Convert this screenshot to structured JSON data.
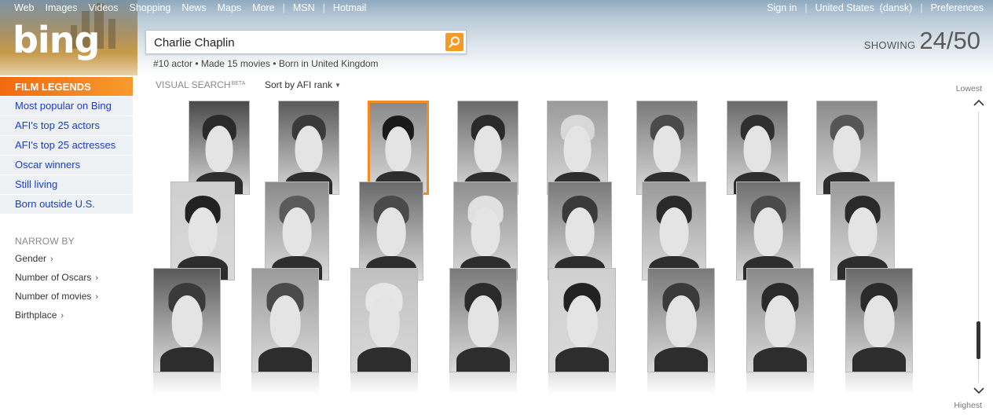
{
  "nav": {
    "left": [
      "Web",
      "Images",
      "Videos",
      "Shopping",
      "News",
      "Maps",
      "More"
    ],
    "msn": "MSN",
    "hotmail": "Hotmail",
    "right": [
      "Sign in",
      "United States  (dansk)",
      "Preferences"
    ]
  },
  "logo": "bing",
  "search": {
    "value": "Charlie Chaplin",
    "button_icon": "search-icon"
  },
  "result_summary": "#10 actor • Made 15 movies • Born in United Kingdom",
  "showing": {
    "label": "SHOWING",
    "count": "24/50",
    "shown": 24,
    "total": 50
  },
  "sidebar": {
    "header": "FILM LEGENDS",
    "items": [
      "Most popular on Bing",
      "AFI's top 25 actors",
      "AFI's top 25 actresses",
      "Oscar winners",
      "Still living",
      "Born outside U.S."
    ],
    "narrow_header": "NARROW BY",
    "narrow_items": [
      "Gender",
      "Number of Oscars",
      "Number of movies",
      "Birthplace"
    ]
  },
  "visual_search": {
    "label": "VISUAL SEARCH",
    "beta": "BETA"
  },
  "sort": {
    "label": "Sort by AFI rank",
    "icon": "dropdown-triangle-icon"
  },
  "results_grid": {
    "rows": [
      [
        {
          "tone": "#4a4a4a",
          "hair": "#2a2a2a"
        },
        {
          "tone": "#5a5a5a",
          "hair": "#3a3a3a"
        },
        {
          "tone": "#8a8a8a",
          "hair": "#1a1a1a",
          "selected": true
        },
        {
          "tone": "#6a6a6a",
          "hair": "#2a2a2a"
        },
        {
          "tone": "#9a9a9a",
          "hair": "#d8d8d8"
        },
        {
          "tone": "#7a7a7a",
          "hair": "#4a4a4a"
        },
        {
          "tone": "#6a6a6a",
          "hair": "#2f2f2f"
        },
        {
          "tone": "#8a8a8a",
          "hair": "#555555"
        }
      ],
      [
        {
          "tone": "#cfcfcf",
          "hair": "#222222"
        },
        {
          "tone": "#8a8a8a",
          "hair": "#5a5a5a"
        },
        {
          "tone": "#6a6a6a",
          "hair": "#4a4a4a"
        },
        {
          "tone": "#8f8f8f",
          "hair": "#e0e0e0"
        },
        {
          "tone": "#7a7a7a",
          "hair": "#3a3a3a"
        },
        {
          "tone": "#9a9a9a",
          "hair": "#2a2a2a"
        },
        {
          "tone": "#6f6f6f",
          "hair": "#4a4a4a"
        },
        {
          "tone": "#9a9a9a",
          "hair": "#2a2a2a"
        }
      ],
      [
        {
          "tone": "#5a5a5a",
          "hair": "#3a3a3a"
        },
        {
          "tone": "#9a9a9a",
          "hair": "#4a4a4a"
        },
        {
          "tone": "#c0c0c0",
          "hair": "#e6e6e6"
        },
        {
          "tone": "#7a7a7a",
          "hair": "#2a2a2a"
        },
        {
          "tone": "#d0d0d0",
          "hair": "#222222"
        },
        {
          "tone": "#7a7a7a",
          "hair": "#3a3a3a"
        },
        {
          "tone": "#8a8a8a",
          "hair": "#2a2a2a"
        },
        {
          "tone": "#6a6a6a",
          "hair": "#2a2a2a"
        }
      ]
    ]
  },
  "slider": {
    "top_label": "Lowest",
    "bottom_label": "Highest",
    "up_icon": "chevron-up-icon",
    "down_icon": "chevron-down-icon",
    "position_fraction": 0.9
  },
  "colors": {
    "accent_orange": "#f58a1f",
    "link_blue": "#1a3dc1",
    "sidebar_bg": "#eef1f4"
  }
}
